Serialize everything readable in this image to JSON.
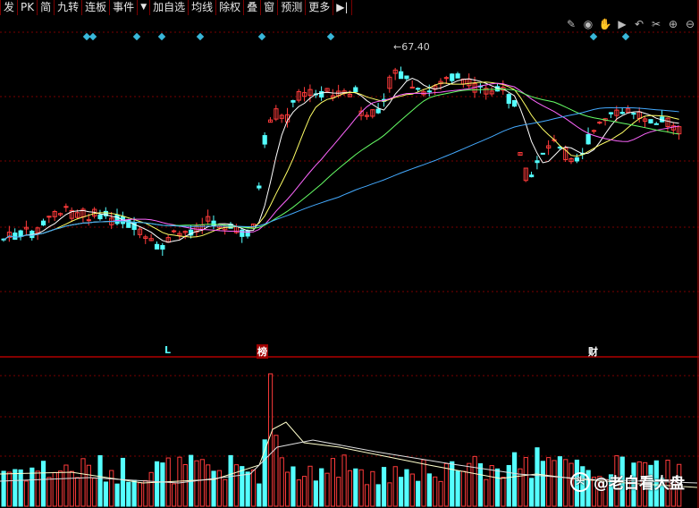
{
  "toolbar": {
    "left_items": [
      "发",
      "PK",
      "简",
      "九转",
      "连板",
      "事件",
      "▼",
      "加自选",
      "均线",
      "除权",
      "叠",
      "窗",
      "预测",
      "更多"
    ]
  },
  "icons": [
    "pencil-icon",
    "eye-icon",
    "hand-icon",
    "play-icon",
    "undo-icon",
    "scissors-icon",
    "zoom-in-icon",
    "zoom-out-icon"
  ],
  "price_flag": "67.40",
  "markers": {
    "l": "L",
    "bang": "榜",
    "cai": "财"
  },
  "watermark": "@老白看大盘",
  "colors": {
    "up": "#ff3b3b",
    "down": "#54ffff",
    "ma5": "#ffffff",
    "ma10": "#ffff66",
    "ma20": "#ff66ff",
    "ma30": "#66ff66",
    "ma60": "#44aaff",
    "grid": "#7a0000"
  },
  "chart_data": {
    "type": "candlestick",
    "ma_lines": [
      "MA5",
      "MA10",
      "MA20",
      "MA30",
      "MA60"
    ],
    "annotated_high": 67.4,
    "volume_panel": true
  }
}
